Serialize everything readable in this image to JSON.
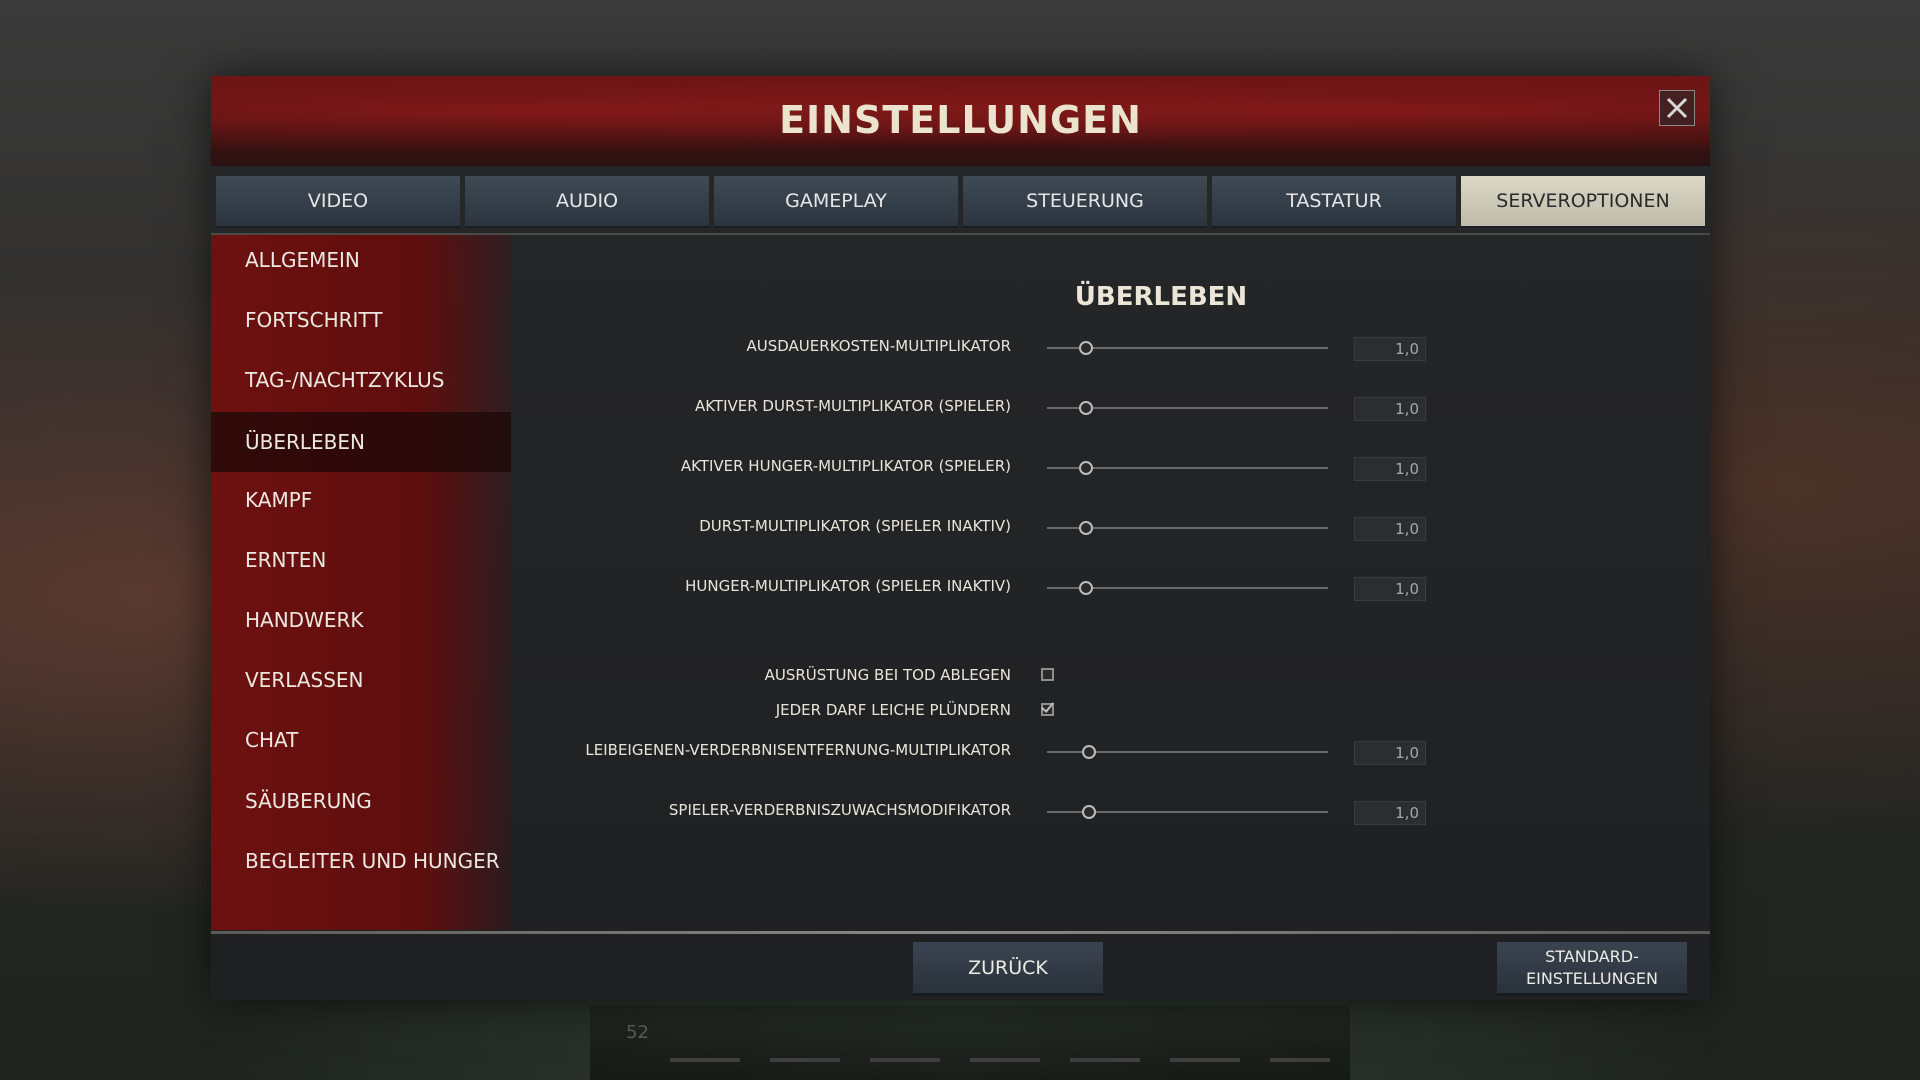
{
  "dialog": {
    "title": "EINSTELLUNGEN",
    "close_icon": "close-icon"
  },
  "tabs": [
    {
      "label": "VIDEO",
      "active": false
    },
    {
      "label": "AUDIO",
      "active": false
    },
    {
      "label": "GAMEPLAY",
      "active": false
    },
    {
      "label": "STEUERUNG",
      "active": false
    },
    {
      "label": "TASTATUR",
      "active": false
    },
    {
      "label": "SERVEROPTIONEN",
      "active": true
    }
  ],
  "sidebar": {
    "items": [
      {
        "label": "ALLGEMEIN"
      },
      {
        "label": "FORTSCHRITT"
      },
      {
        "label": "TAG-/NACHTZYKLUS"
      },
      {
        "label": "ÜBERLEBEN",
        "active": true
      },
      {
        "label": "KAMPF"
      },
      {
        "label": "ERNTEN"
      },
      {
        "label": "HANDWERK"
      },
      {
        "label": "VERLASSEN"
      },
      {
        "label": "CHAT"
      },
      {
        "label": "SÄUBERUNG"
      },
      {
        "label": "BEGLEITER UND HUNGER"
      }
    ]
  },
  "section": {
    "title": "ÜBERLEBEN",
    "settings": [
      {
        "label": "AUSDAUERKOSTEN-MULTIPLIKATOR",
        "value": "1,0",
        "level": 0.14
      },
      {
        "label": "AKTIVER DURST-MULTIPLIKATOR (SPIELER)",
        "value": "1,0",
        "level": 0.14
      },
      {
        "label": "AKTIVER HUNGER-MULTIPLIKATOR (SPIELER)",
        "value": "1,0",
        "level": 0.14
      },
      {
        "label": "DURST-MULTIPLIKATOR (SPIELER INAKTIV)",
        "value": "1,0",
        "level": 0.14
      },
      {
        "label": "HUNGER-MULTIPLIKATOR (SPIELER INAKTIV)",
        "value": "1,0",
        "level": 0.14
      }
    ],
    "checkboxes": [
      {
        "label": "AUSRÜSTUNG BEI TOD ABLEGEN",
        "checked": false
      },
      {
        "label": "JEDER DARF LEICHE PLÜNDERN",
        "checked": true
      }
    ],
    "settings2": [
      {
        "label": "LEIBEIGENEN-VERDERBNISENTFERNUNG-MULTIPLIKATOR",
        "value": "1,0",
        "level": 0.15
      },
      {
        "label": "SPIELER-VERDERBNISZUWACHSMODIFIKATOR",
        "value": "1,0",
        "level": 0.15
      }
    ]
  },
  "footer": {
    "back_label": "ZURÜCK",
    "defaults_line1": "STANDARD-",
    "defaults_line2": "EINSTELLUNGEN"
  },
  "hud": {
    "number": "52"
  },
  "colors": {
    "accent_red": "#6e1010",
    "active_tab": "#dcd8c8",
    "tab": "#3f4a55"
  }
}
